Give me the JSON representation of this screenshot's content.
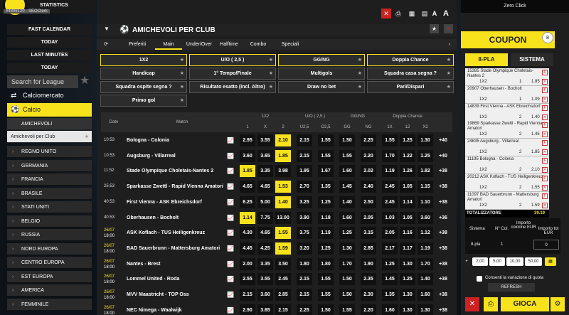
{
  "top": {
    "id_tag": "#4896120 - SEOClerk",
    "stats": "STATISTICS"
  },
  "left": {
    "fast_calendar": "FAST CALENDAR",
    "today1": "TODAY",
    "last_minutes": "LAST MINUTES",
    "today2": "TODAY",
    "search_placeholder": "Search for League",
    "calciomercato": "Calciomercato",
    "calcio": "Calcio",
    "amichevoli": "AMICHEVOLI",
    "selected_league": "Amichevoli per Club",
    "countries": [
      "REGNO UNITO",
      "GERMANIA",
      "FRANCIA",
      "BRASILE",
      "STATI UNITI",
      "BELGIO",
      "RUSSIA",
      "NORD EUROPA",
      "CENTRO EUROPA",
      "EST EUROPA",
      "AMERICA",
      "FEMMINILE"
    ]
  },
  "center": {
    "title": "AMICHEVOLI PER CLUB",
    "tabs": [
      "Preferiti",
      "Main",
      "Under/Over",
      "Halftime",
      "Combo",
      "Speciali"
    ],
    "markets_row1": [
      "1X2",
      "U/O ( 2,5 )",
      "GG/NG",
      "Doppia Chance"
    ],
    "markets_row2": [
      "Handicap",
      "1° Tempo/Finale",
      "Multigols",
      "Squadra casa segna ?"
    ],
    "markets_row3": [
      "Squadra ospite segna ?",
      "Risultato esatto (incl. Altro)",
      "Draw no bet",
      "Pari/Dispari"
    ],
    "markets_row4": [
      "Primo gol"
    ],
    "groups": [
      "1X2",
      "U/O ( 2,5 )",
      "GG/NG",
      "Doppia Chance"
    ],
    "col_date": "Date",
    "col_match": "Match",
    "cols": [
      "1",
      "X",
      "2",
      "U2,5",
      "O2,5",
      "GG",
      "NG",
      "1X",
      "12",
      "X2"
    ],
    "rows": [
      {
        "d1": "10:53",
        "d2": "",
        "m": "Bologna - Colonia",
        "o": [
          "2.95",
          "3.55",
          "2.10",
          "2.15",
          "1.55",
          "1.50",
          "2.25",
          "1.55",
          "1.25",
          "1.30"
        ],
        "h": 2,
        "more": "+40"
      },
      {
        "d1": "10:53",
        "d2": "",
        "m": "Augsburg - Villarreal",
        "o": [
          "3.60",
          "3.65",
          "1.85",
          "2.15",
          "1.55",
          "1.55",
          "2.20",
          "1.70",
          "1.22",
          "1.25"
        ],
        "h": 2,
        "more": "+40"
      },
      {
        "d1": "11:52",
        "d2": "",
        "m": "Stade Olympique Choletais-Nantes 2",
        "o": [
          "1.85",
          "3.35",
          "3.98",
          "1.95",
          "1.67",
          "1.60",
          "2.02",
          "1.19",
          "1.26",
          "1.82"
        ],
        "h": 0,
        "more": "+38"
      },
      {
        "d1": "25:53",
        "d2": "",
        "m": "Sparkasse Zwettl - Rapid Vienna Amatori",
        "o": [
          "4.65",
          "4.65",
          "1.53",
          "2.70",
          "1.35",
          "1.45",
          "2.40",
          "2.45",
          "1.05",
          "1.15"
        ],
        "h": 2,
        "more": "+38"
      },
      {
        "d1": "40:53",
        "d2": "",
        "m": "First Vienna - ASK Ebreichsdorf",
        "o": [
          "6.25",
          "5.00",
          "1.40",
          "3.25",
          "1.25",
          "1.40",
          "2.50",
          "2.45",
          "1.14",
          "1.10"
        ],
        "h": 2,
        "more": "+38"
      },
      {
        "d1": "40:53",
        "d2": "",
        "m": "Oberhausen - Bocholt",
        "o": [
          "1.14",
          "7.75",
          "13.00",
          "3.90",
          "1.18",
          "1.60",
          "2.05",
          "1.03",
          "1.05",
          "3.60"
        ],
        "h": 0,
        "more": "+36"
      },
      {
        "d1": "26/07",
        "d2": "18:00",
        "m": "ASK Koflach - TUS Heiligenkreuz",
        "o": [
          "4.30",
          "4.65",
          "1.55",
          "3.75",
          "1.19",
          "1.25",
          "3.15",
          "2.05",
          "1.16",
          "1.12"
        ],
        "h": 2,
        "more": "+38"
      },
      {
        "d1": "26/07",
        "d2": "18:00",
        "m": "BAD Sauerbrunn - Mattersburg Amatori",
        "o": [
          "4.45",
          "4.25",
          "1.59",
          "3.20",
          "1.25",
          "1.30",
          "2.85",
          "2.17",
          "1.17",
          "1.19"
        ],
        "h": 2,
        "more": "+38"
      },
      {
        "d1": "26/07",
        "d2": "18:00",
        "m": "Nantes - Brest",
        "o": [
          "2.00",
          "3.35",
          "3.50",
          "1.80",
          "1.80",
          "1.70",
          "1.90",
          "1.25",
          "1.30",
          "1.70"
        ],
        "h": -1,
        "more": "+38"
      },
      {
        "d1": "26/07",
        "d2": "18:00",
        "m": "Lommel United - Roda",
        "o": [
          "2.55",
          "3.55",
          "2.45",
          "2.15",
          "1.55",
          "1.50",
          "2.35",
          "1.45",
          "1.25",
          "1.40"
        ],
        "h": -1,
        "more": "+38"
      },
      {
        "d1": "26/07",
        "d2": "18:00",
        "m": "MVV Maastricht - TOP Oss",
        "o": [
          "2.15",
          "3.60",
          "2.85",
          "2.15",
          "1.55",
          "1.50",
          "2.30",
          "1.35",
          "1.30",
          "1.60"
        ],
        "h": -1,
        "more": "+38"
      },
      {
        "d1": "26/07",
        "d2": "18:00",
        "m": "NEC Nimega - Waalwijk",
        "o": [
          "2.90",
          "3.65",
          "2.15",
          "2.25",
          "1.50",
          "1.55",
          "2.20",
          "1.60",
          "1.30",
          "1.30"
        ],
        "h": -1,
        "more": "+38"
      }
    ]
  },
  "right": {
    "zero_click": "Zero Click",
    "coupon": "COUPON",
    "count": "8",
    "tab1": "8-PLA",
    "tab2": "SISTEMA",
    "slips": [
      {
        "n": "15385 Stade Olympique Choletais-Nantes 2",
        "k": "1X2",
        "w": "1",
        "v": "1.85"
      },
      {
        "n": "20907 Oberhausen - Bocholt",
        "k": "1X2",
        "w": "1",
        "v": "1.09"
      },
      {
        "n": "14839 First Vienna - ASK Ebreichsdorf",
        "k": "1X2",
        "w": "2",
        "v": "1.40"
      },
      {
        "n": "19869 Sparkasse Zwettl - Rapid Vienna Amatori",
        "k": "1X2",
        "w": "2",
        "v": "1.45"
      },
      {
        "n": "24635 Augsburg - Villarreal",
        "k": "1X2",
        "w": "2",
        "v": "1.85"
      },
      {
        "n": "11195 Bologna - Colonia",
        "k": "1X2",
        "w": "2",
        "v": "2.10"
      },
      {
        "n": "20212 ASK Koflach - TUS Heiligenkreuz",
        "k": "1X2",
        "w": "2",
        "v": "1.55"
      },
      {
        "n": "11097 BAD Sauerbrunn - Mattersburg Amatori",
        "k": "1X2",
        "w": "2",
        "v": "1.59"
      }
    ],
    "totalizzatore": "TOTALIZZATORE",
    "total_value": "39.19",
    "sis_h1": "Sistema",
    "sis_h2": "N° Col.",
    "sis_h3": "Importo colonne EUR",
    "sis_h4": "Importo tot EUR",
    "sis_v1": "8-pla",
    "sis_v2": "1",
    "sis_v4": "0",
    "amounts": [
      "2,00",
      "5,00",
      "10,00",
      "50,00"
    ],
    "consent": "Consenti la variazione di quota",
    "refresh": "REFRESH",
    "gioca": "GIOCA"
  }
}
